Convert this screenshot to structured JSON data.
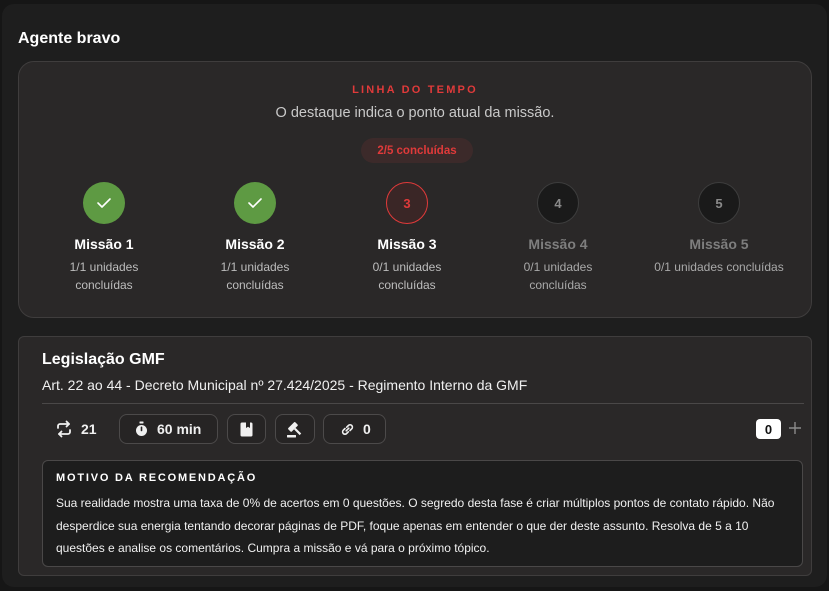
{
  "agent": {
    "title": "Agente bravo"
  },
  "timeline": {
    "label": "LINHA DO TEMPO",
    "subtitle": "O destaque indica o ponto atual da missão.",
    "progress_badge": "2/5 concluídas",
    "progress": {
      "done": 2,
      "total": 5
    },
    "missions": [
      {
        "name": "Missão 1",
        "status": "done",
        "marker": "check-icon",
        "units_line1": "1/1 unidades",
        "units_line2": "concluídas"
      },
      {
        "name": "Missão 2",
        "status": "done",
        "marker": "check-icon",
        "units_line1": "1/1 unidades",
        "units_line2": "concluídas"
      },
      {
        "name": "Missão 3",
        "status": "current",
        "marker": "3",
        "units_line1": "0/1 unidades",
        "units_line2": "concluídas"
      },
      {
        "name": "Missão 4",
        "status": "pending",
        "marker": "4",
        "units_line1": "0/1 unidades",
        "units_line2": "concluídas"
      },
      {
        "name": "Missão 5",
        "status": "pending",
        "marker": "5",
        "units_line1": "0/1 unidades concluídas",
        "units_line2": ""
      }
    ]
  },
  "subject": {
    "title": "Legislação GMF",
    "description": "Art. 22 ao 44 - Decreto Municipal nº 27.424/2025 - Regimento Interno da GMF",
    "stats": {
      "repeat": {
        "icon": "repeat-icon",
        "value": "21"
      },
      "timer": {
        "icon": "stopwatch-icon",
        "value": "60 min"
      },
      "book": {
        "icon": "book-icon"
      },
      "law": {
        "icon": "gavel-icon"
      },
      "links": {
        "icon": "link-icon",
        "value": "0"
      }
    },
    "counter": "0",
    "plus_icon": "plus-icon",
    "reason": {
      "title": "MOTIVO DA RECOMENDAÇÃO",
      "text": "Sua realidade mostra uma taxa de 0% de acertos em 0 questões. O segredo desta fase é criar múltiplos pontos de contato rápido. Não desperdice sua energia tentando decorar páginas de PDF, foque apenas em entender o que der deste assunto. Resolva de 5 a 10 questões e analise os comentários. Cumpra a missão e vá para o próximo tópico."
    }
  },
  "colors": {
    "accent": "#e03a3a",
    "done": "#5e9a43",
    "background": "#1e1e1e",
    "card": "#2a2828"
  }
}
